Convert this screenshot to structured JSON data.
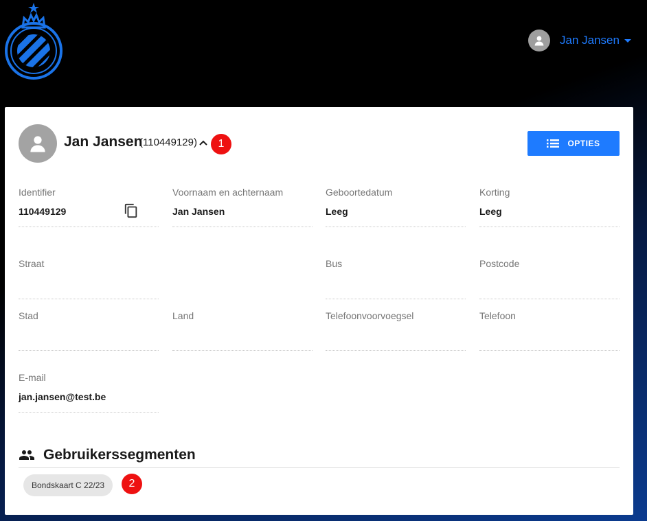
{
  "header": {
    "logo_icon": "club-brugge-crest-icon",
    "user_name": "Jan Jansen"
  },
  "profile": {
    "name": "Jan Jansen",
    "id_display": "(110449129)",
    "options_label": "OPTIES"
  },
  "fields": {
    "identifier": {
      "label": "Identifier",
      "value": "110449129"
    },
    "full_name": {
      "label": "Voornaam en achternaam",
      "value": "Jan Jansen"
    },
    "birthdate": {
      "label": "Geboortedatum",
      "value": "Leeg"
    },
    "discount": {
      "label": "Korting",
      "value": "Leeg"
    },
    "street": {
      "label": "Straat",
      "value": ""
    },
    "bus": {
      "label": "Bus",
      "value": ""
    },
    "postcode": {
      "label": "Postcode",
      "value": ""
    },
    "city": {
      "label": "Stad",
      "value": ""
    },
    "country": {
      "label": "Land",
      "value": ""
    },
    "phone_prefix": {
      "label": "Telefoonvoorvoegsel",
      "value": ""
    },
    "phone": {
      "label": "Telefoon",
      "value": ""
    },
    "email": {
      "label": "E-mail",
      "value": "jan.jansen@test.be"
    }
  },
  "segments": {
    "title": "Gebruikerssegmenten",
    "items": [
      "Bondskaart C 22/23"
    ]
  },
  "markers": [
    "1",
    "2"
  ],
  "colors": {
    "accent": "#1e7bff",
    "marker": "#ee1111",
    "logo_blue": "#1a73e8"
  }
}
